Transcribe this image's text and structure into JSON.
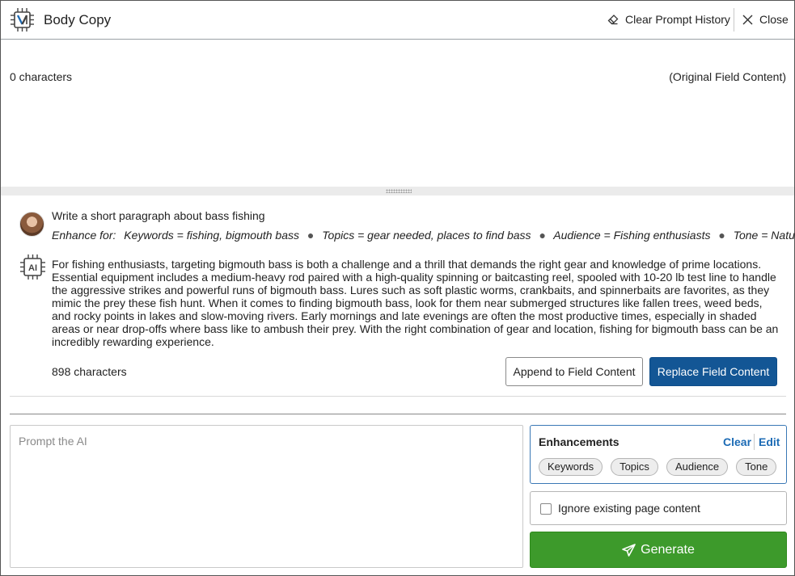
{
  "header": {
    "title": "Body Copy",
    "clear_history_label": "Clear Prompt History",
    "close_label": "Close"
  },
  "original": {
    "char_count": "0 characters",
    "label": "(Original Field Content)"
  },
  "conversation": {
    "prompt": "Write a short paragraph about bass fishing",
    "enhance_label": "Enhance for:",
    "enhancements": [
      "Keywords = fishing, bigmouth bass",
      "Topics = gear needed, places to find bass",
      "Audience = Fishing enthusiasts",
      "Tone = Natural"
    ],
    "bullet": "●",
    "ai_icon_label": "AI",
    "response": "For fishing enthusiasts, targeting bigmouth bass is both a challenge and a thrill that demands the right gear and knowledge of prime locations. Essential equipment includes a medium-heavy rod paired with a high-quality spinning or baitcasting reel, spooled with 10-20 lb test line to handle the aggressive strikes and powerful runs of bigmouth bass. Lures such as soft plastic worms, crankbaits, and spinnerbaits are favorites, as they mimic the prey these fish hunt. When it comes to finding bigmouth bass, look for them near submerged structures like fallen trees, weed beds, and rocky points in lakes and slow-moving rivers. Early mornings and late evenings are often the most productive times, especially in shaded areas or near drop-offs where bass like to ambush their prey. With the right combination of gear and location, fishing for bigmouth bass can be an incredibly rewarding experience.",
    "response_char_count": "898 characters",
    "append_label": "Append to Field Content",
    "replace_label": "Replace Field Content"
  },
  "prompt_input": {
    "placeholder": "Prompt the AI",
    "value": ""
  },
  "enhancements_panel": {
    "title": "Enhancements",
    "clear_label": "Clear",
    "edit_label": "Edit",
    "chips": [
      "Keywords",
      "Topics",
      "Audience",
      "Tone"
    ]
  },
  "ignore_option": {
    "label": "Ignore existing page content",
    "checked": false
  },
  "generate_label": "Generate",
  "colors": {
    "primary_blue": "#135695",
    "link_blue": "#1c6bb5",
    "generate_green": "#3d9a2b"
  },
  "icons": {
    "logo": "ai-chip-logo-icon",
    "clear_history": "eraser-icon",
    "close": "close-icon",
    "ai": "ai-chip-icon",
    "generate": "paper-plane-icon"
  }
}
